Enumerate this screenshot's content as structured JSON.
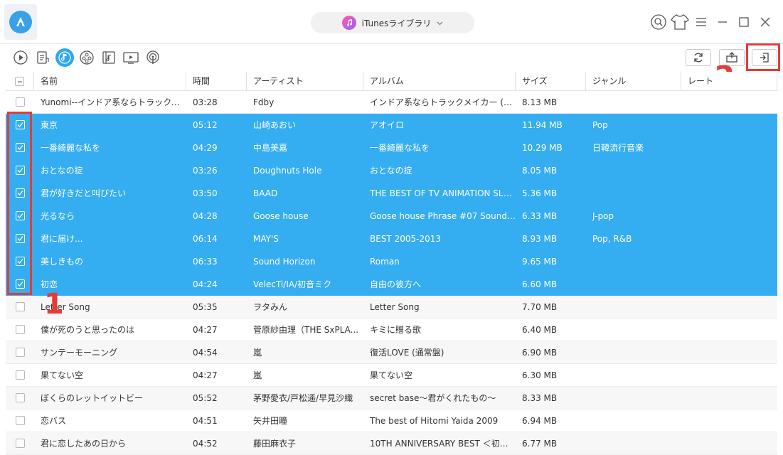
{
  "titlebar": {
    "source_label": "iTunesライブラリ"
  },
  "toolbar": {
    "categories": [
      "play-icon",
      "playlist-icon",
      "music-icon",
      "video-icon",
      "movie-icon",
      "tv-icon",
      "podcast-icon"
    ],
    "active_category": "music-icon"
  },
  "annotations": {
    "label_1": "1",
    "label_2": "2"
  },
  "table": {
    "columns": [
      "名前",
      "時間",
      "アーティスト",
      "アルバム",
      "サイズ",
      "ジャンル",
      "レート"
    ],
    "rows": [
      {
        "name": "Yunomi--インドア系ならトラックメイカー...",
        "time": "03:28",
        "artist": "Fdby",
        "album": "インドア系ならトラックメイカー (Fdby Re...",
        "size": "8.13 MB",
        "genre": "",
        "selected": false
      },
      {
        "name": "東京",
        "time": "05:12",
        "artist": "山崎あおい",
        "album": "アオイロ",
        "size": "11.94 MB",
        "genre": "Pop",
        "selected": true
      },
      {
        "name": "一番綺麗な私を",
        "time": "04:29",
        "artist": "中島美嘉",
        "album": "一番綺麗な私を",
        "size": "10.29 MB",
        "genre": "日韓流行音楽",
        "selected": true
      },
      {
        "name": "おとなの掟",
        "time": "03:26",
        "artist": "Doughnuts Hole",
        "album": "おとなの掟",
        "size": "8.05 MB",
        "genre": "",
        "selected": true
      },
      {
        "name": "君が好きだと叫びたい",
        "time": "03:50",
        "artist": "BAAD",
        "album": "THE BEST OF TV ANIMATION SLA...",
        "size": "5.36 MB",
        "genre": "",
        "selected": true
      },
      {
        "name": "光るなら",
        "time": "04:28",
        "artist": "Goose house",
        "album": "Goose house Phrase #07 Soundtrac...",
        "size": "6.33 MB",
        "genre": "J-pop",
        "selected": true
      },
      {
        "name": "君に届け...",
        "time": "06:14",
        "artist": "MAY'S",
        "album": "BEST 2005-2013",
        "size": "8.93 MB",
        "genre": "Pop, R&B",
        "selected": true
      },
      {
        "name": "美しきもの",
        "time": "06:33",
        "artist": "Sound Horizon",
        "album": "Roman",
        "size": "9.65 MB",
        "genre": "",
        "selected": true
      },
      {
        "name": "初恋",
        "time": "04:24",
        "artist": "VelecTi/IA/初音ミク",
        "album": "自由の彼方へ",
        "size": "6.60 MB",
        "genre": "",
        "selected": true
      },
      {
        "name": "Letter Song",
        "time": "05:35",
        "artist": "ヲタみん",
        "album": "Letter Song",
        "size": "7.70 MB",
        "genre": "",
        "selected": false
      },
      {
        "name": "僕が死のうと思ったのは",
        "time": "04:27",
        "artist": "菅原紗由理（THE SxPLA...",
        "album": "キミに贈る歌",
        "size": "6.40 MB",
        "genre": "",
        "selected": false
      },
      {
        "name": "サンテーモーニング",
        "time": "04:54",
        "artist": "嵐",
        "album": "復活LOVE (通常盤)",
        "size": "6.90 MB",
        "genre": "",
        "selected": false
      },
      {
        "name": "果てない空",
        "time": "04:27",
        "artist": "嵐",
        "album": "果てない空",
        "size": "6.30 MB",
        "genre": "",
        "selected": false
      },
      {
        "name": "ぼくらのレットイットビー",
        "time": "05:52",
        "artist": "茅野愛衣/戸松遥/早見沙織",
        "album": "secret base〜君がくれたもの〜",
        "size": "8.33 MB",
        "genre": "",
        "selected": false
      },
      {
        "name": "恋バス",
        "time": "04:51",
        "artist": "矢井田瞳",
        "album": "The best of Hitomi Yaida 2009",
        "size": "6.94 MB",
        "genre": "",
        "selected": false
      },
      {
        "name": "君に恋したあの日から",
        "time": "04:52",
        "artist": "藤田麻衣子",
        "album": "10TH ANNIVERSARY BEST ＜初回...",
        "size": "6.77 MB",
        "genre": "",
        "selected": false
      }
    ]
  }
}
